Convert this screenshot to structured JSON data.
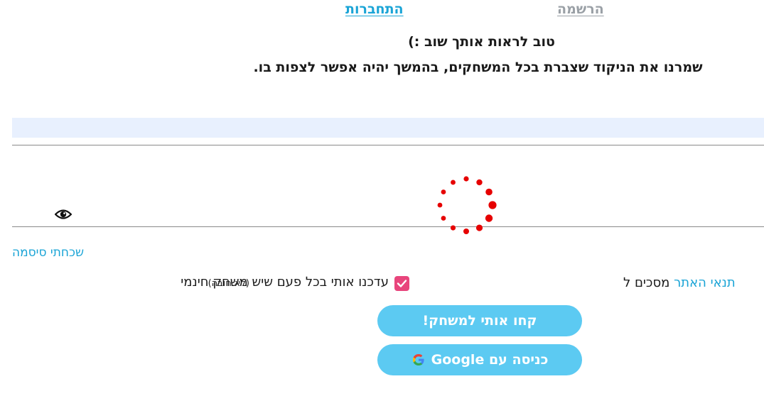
{
  "tabs": {
    "login": "התחברות",
    "register": "הרשמה"
  },
  "messages": {
    "welcome_back": "טוב לראות אותך שוב :)",
    "score_saved": "שמרנו את הניקוד שצברת בכל המשחקים, בהמשך יהיה אפשר לצפות בו."
  },
  "form": {
    "forgot_password": "שכחתי סיסמה",
    "terms_prefix": "מסכים ל",
    "terms_link": "תנאי האתר",
    "terms_checkbox_checked": true,
    "notify_label": "עדכנו אותי בכל פעם שיש משחק חינמי",
    "notify_optional": "(לא חובה)",
    "notify_checked": true
  },
  "buttons": {
    "play": "קחו אותי למשחק!",
    "google": "כניסה עם Google"
  },
  "icons": {
    "eye": "eye-icon",
    "spinner": "loading-spinner",
    "google": "google-icon",
    "checkbox": "checkmark-icon"
  },
  "colors": {
    "accent_blue": "#1aa4d6",
    "button_blue": "#5ccaf2",
    "checkbox_pink": "#e8457c",
    "spinner_red": "#e60000",
    "input_fill": "#e8f0fe",
    "muted_tab": "#9aa0a6"
  }
}
